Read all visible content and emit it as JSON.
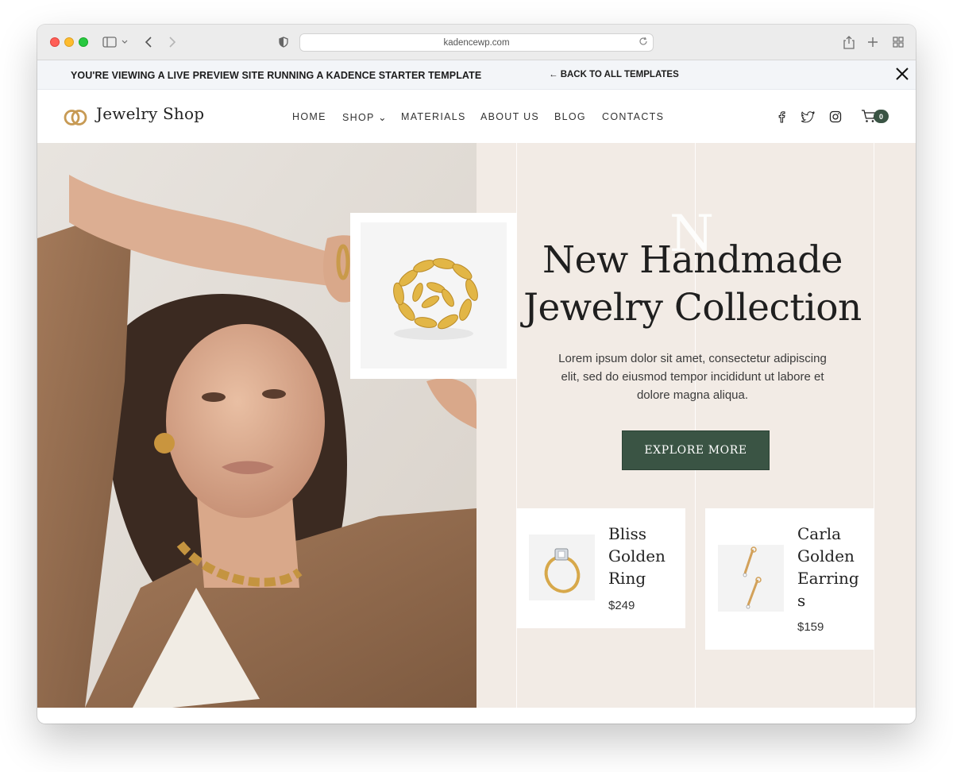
{
  "browser": {
    "url": "kadencewp.com"
  },
  "banner": {
    "notice": "YOU'RE VIEWING A LIVE PREVIEW SITE RUNNING A KADENCE STARTER TEMPLATE",
    "back_link": "← BACK TO ALL TEMPLATES"
  },
  "header": {
    "logo_text": "Jewelry Shop",
    "nav": [
      "HOME",
      "SHOP ⌄",
      "MATERIALS",
      "ABOUT US",
      "BLOG",
      "CONTACTS"
    ],
    "social_icons": [
      "facebook-icon",
      "twitter-icon",
      "instagram-icon"
    ],
    "cart_count": "0"
  },
  "hero": {
    "ghost_letter": "N",
    "title_line1": "New Handmade",
    "title_line2": "Jewelry Collection",
    "text": "Lorem ipsum dolor sit amet, consectetur adipiscing elit, sed do eiusmod tempor incididunt ut labore et dolore magna aliqua.",
    "button": "EXPLORE MORE"
  },
  "products": [
    {
      "name": "Bliss Golden Ring",
      "price": "$249"
    },
    {
      "name": "Carla Golden Earring s",
      "price": "$159"
    }
  ],
  "colors": {
    "accent_green": "#3a5444",
    "hero_bg": "#f2ebe5",
    "banner_bg": "#f3f5f8",
    "logo_gold": "#c79a54"
  }
}
